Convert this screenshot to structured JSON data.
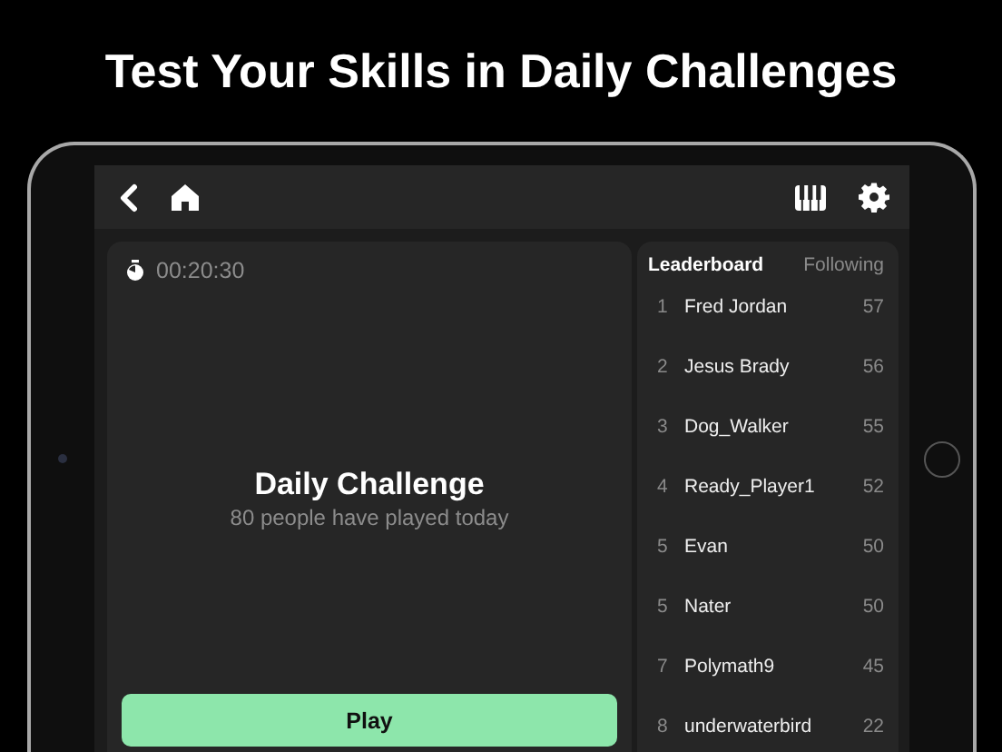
{
  "headline": "Test Your Skills in Daily Challenges",
  "timer": "00:20:30",
  "challenge": {
    "title": "Daily Challenge",
    "subtitle": "80 people have played today",
    "button": "Play"
  },
  "tabs": [
    {
      "label": "Leaderboard",
      "selected": true
    },
    {
      "label": "Following",
      "selected": false
    }
  ],
  "leaderboard": [
    {
      "rank": "1",
      "name": "Fred Jordan",
      "score": "57"
    },
    {
      "rank": "2",
      "name": "Jesus Brady",
      "score": "56"
    },
    {
      "rank": "3",
      "name": "Dog_Walker",
      "score": "55"
    },
    {
      "rank": "4",
      "name": "Ready_Player1",
      "score": "52"
    },
    {
      "rank": "5",
      "name": "Evan",
      "score": "50"
    },
    {
      "rank": "5",
      "name": "Nater",
      "score": "50"
    },
    {
      "rank": "7",
      "name": "Polymath9",
      "score": "45"
    },
    {
      "rank": "8",
      "name": "underwaterbird",
      "score": "22"
    }
  ]
}
